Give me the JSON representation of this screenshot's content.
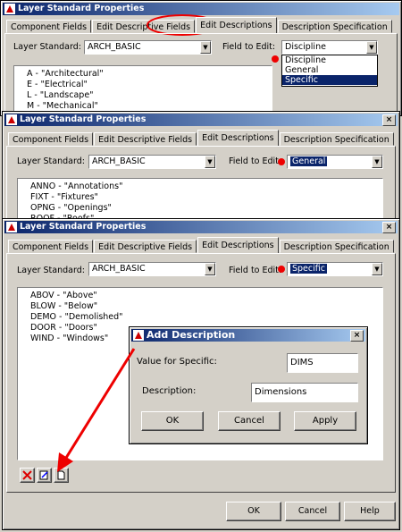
{
  "window_title": "Layer Standard Properties",
  "close_glyph": "×",
  "tabs": [
    "Component Fields",
    "Edit Descriptive Fields",
    "Edit Descriptions",
    "Description Specification"
  ],
  "layer_standard_label": "Layer Standard:",
  "field_to_edit_label": "Field to Edit:",
  "layer_standard_value": "ARCH_BASIC",
  "panel1": {
    "field_value": "Discipline",
    "dropdown_options": [
      "Discipline",
      "General",
      "Specific"
    ],
    "dropdown_highlighted": "Specific",
    "items": [
      "A - \"Architectural\"",
      "E - \"Electrical\"",
      "L - \"Landscape\"",
      "M - \"Mechanical\""
    ]
  },
  "panel2": {
    "field_value": "General",
    "items": [
      "ANNO - \"Annotations\"",
      "FIXT - \"Fixtures\"",
      "OPNG - \"Openings\"",
      "ROOF - \"Roofs\""
    ]
  },
  "panel3": {
    "field_value": "Specific",
    "items": [
      "ABOV - \"Above\"",
      "BLOW - \"Below\"",
      "DEMO - \"Demolished\"",
      "DOOR - \"Doors\"",
      "WIND - \"Windows\""
    ]
  },
  "dialog": {
    "title": "Add Description",
    "value_label": "Value for Specific:",
    "value": "DIMS",
    "description_label": "Description:",
    "description": "Dimensions",
    "ok": "OK",
    "cancel": "Cancel",
    "apply": "Apply"
  },
  "footer": {
    "ok": "OK",
    "cancel": "Cancel",
    "help": "Help"
  },
  "colors": {
    "title_bar": "#0a246a",
    "annotation_red": "#e00000",
    "highlight": "#0a246a"
  }
}
